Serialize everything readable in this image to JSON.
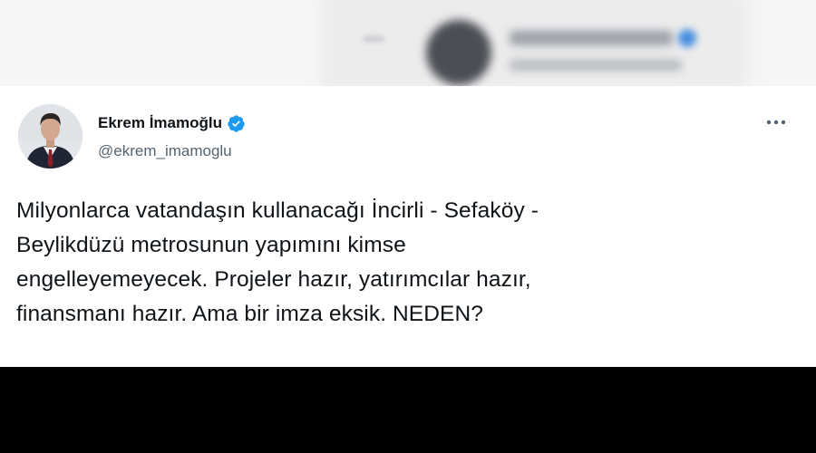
{
  "tweet": {
    "author_name": "Ekrem İmamoğlu",
    "author_handle": "@ekrem_imamoglu",
    "text_lines": [
      "Milyonlarca vatandaşın kullanacağı İncirli - Sefaköy -",
      "Beylikdüzü metrosunun yapımını kimse",
      "engelleyemeyecek. Projeler hazır, yatırımcılar hazır,",
      "finansmanı hazır. Ama bir imza eksik. NEDEN?"
    ],
    "verified": true,
    "icons": {
      "verified": "verified-badge-icon",
      "more": "more-options-icon"
    },
    "colors": {
      "verified_blue": "#1d9bf0",
      "text_primary": "#0f1419",
      "text_secondary": "#536471",
      "card_bg": "#ffffff"
    }
  }
}
